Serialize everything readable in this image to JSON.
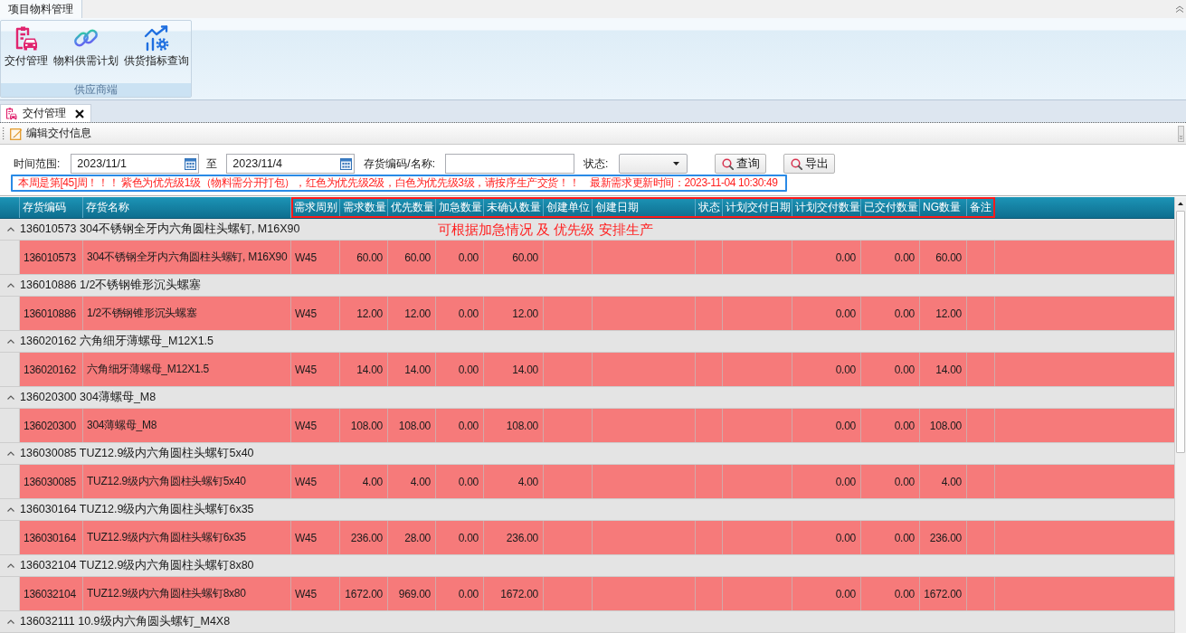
{
  "ribbon_tabs": [
    {
      "label": "项目物料管理",
      "selected": true
    }
  ],
  "ribbon": {
    "groups": [
      {
        "caption": "供应商端",
        "buttons": [
          {
            "label": "交付管理"
          },
          {
            "label": "物料供需计划"
          },
          {
            "label": "供货指标查询"
          }
        ]
      }
    ]
  },
  "document_tabs": [
    {
      "label": "交付管理",
      "selected": true
    }
  ],
  "toolbar": {
    "buttons": [
      {
        "label": "编辑交付信息"
      }
    ]
  },
  "filters": {
    "time_range": {
      "label": "时间范围:",
      "from": "2023/11/1",
      "separator": "至",
      "to": "2023/11/4"
    },
    "item": {
      "label": "存货编码/名称:"
    },
    "status": {
      "label": "状态:"
    },
    "buttons": [
      {
        "label": "查询"
      },
      {
        "label": "导出"
      }
    ]
  },
  "notice": {
    "message": "本周是第[45]周！！！ 紫色为优先级1级（物料需分开打包），红色为优先级2级，白色为优先级3级，请按序生产交货！！",
    "update_time": "最新需求更新时间：2023-11-04 10:30:49"
  },
  "table": {
    "columns": [
      {
        "label": "存货编码",
        "highlighted": false
      },
      {
        "label": "存货名称",
        "highlighted": false
      },
      {
        "label": "需求周别",
        "highlighted": true
      },
      {
        "label": "需求数量",
        "highlighted": true
      },
      {
        "label": "优先数量",
        "highlighted": true
      },
      {
        "label": "加急数量",
        "highlighted": true
      },
      {
        "label": "未确认数量",
        "highlighted": true
      },
      {
        "label": "创建单位",
        "highlighted": true
      },
      {
        "label": "创建日期",
        "highlighted": true
      },
      {
        "label": "状态",
        "highlighted": true
      },
      {
        "label": "计划交付日期",
        "highlighted": true
      },
      {
        "label": "计划交付数量",
        "highlighted": true
      },
      {
        "label": "已交付数量",
        "highlighted": true
      },
      {
        "label": "NG数量",
        "highlighted": true
      },
      {
        "label": "备注",
        "highlighted": true
      }
    ],
    "annotation": "可根据加急情况 及 优先级 安排生产",
    "groups": [
      {
        "title": "136010573 304不锈钢全牙内六角圆柱头螺钉, M16X90",
        "expanded": true,
        "rows": [
          {
            "color": "#f67a7a",
            "code": "136010573",
            "name": "304不锈钢全牙内六角圆柱头螺钉, M16X90",
            "week": "W45",
            "demand_qty": "60.00",
            "priority_qty": "60.00",
            "urgent_qty": "0.00",
            "unconfirmed_qty": "60.00",
            "planned_delivery_qty": "0.00",
            "delivered_qty": "0.00",
            "ng_qty": "60.00"
          }
        ]
      },
      {
        "title": "136010886 1/2不锈钢锥形沉头螺塞",
        "expanded": true,
        "rows": [
          {
            "color": "#f67a7a",
            "code": "136010886",
            "name": "1/2不锈钢锥形沉头螺塞",
            "week": "W45",
            "demand_qty": "12.00",
            "priority_qty": "12.00",
            "urgent_qty": "0.00",
            "unconfirmed_qty": "12.00",
            "planned_delivery_qty": "0.00",
            "delivered_qty": "0.00",
            "ng_qty": "12.00"
          }
        ]
      },
      {
        "title": "136020162 六角细牙薄螺母_M12X1.5",
        "expanded": true,
        "rows": [
          {
            "color": "#f67a7a",
            "code": "136020162",
            "name": "六角细牙薄螺母_M12X1.5",
            "week": "W45",
            "demand_qty": "14.00",
            "priority_qty": "14.00",
            "urgent_qty": "0.00",
            "unconfirmed_qty": "14.00",
            "planned_delivery_qty": "0.00",
            "delivered_qty": "0.00",
            "ng_qty": "14.00"
          }
        ]
      },
      {
        "title": "136020300 304薄螺母_M8",
        "expanded": true,
        "rows": [
          {
            "color": "#f67a7a",
            "code": "136020300",
            "name": "304薄螺母_M8",
            "week": "W45",
            "demand_qty": "108.00",
            "priority_qty": "108.00",
            "urgent_qty": "0.00",
            "unconfirmed_qty": "108.00",
            "planned_delivery_qty": "0.00",
            "delivered_qty": "0.00",
            "ng_qty": "108.00"
          }
        ]
      },
      {
        "title": "136030085 TUZ12.9级内六角圆柱头螺钉5x40",
        "expanded": true,
        "rows": [
          {
            "color": "#f67a7a",
            "code": "136030085",
            "name": "TUZ12.9级内六角圆柱头螺钉5x40",
            "week": "W45",
            "demand_qty": "4.00",
            "priority_qty": "4.00",
            "urgent_qty": "0.00",
            "unconfirmed_qty": "4.00",
            "planned_delivery_qty": "0.00",
            "delivered_qty": "0.00",
            "ng_qty": "4.00"
          }
        ]
      },
      {
        "title": "136030164 TUZ12.9级内六角圆柱头螺钉6x35",
        "expanded": true,
        "rows": [
          {
            "color": "#f67a7a",
            "code": "136030164",
            "name": "TUZ12.9级内六角圆柱头螺钉6x35",
            "week": "W45",
            "demand_qty": "236.00",
            "priority_qty": "28.00",
            "urgent_qty": "0.00",
            "unconfirmed_qty": "236.00",
            "planned_delivery_qty": "0.00",
            "delivered_qty": "0.00",
            "ng_qty": "236.00"
          }
        ]
      },
      {
        "title": "136032104 TUZ12.9级内六角圆柱头螺钉8x80",
        "expanded": true,
        "rows": [
          {
            "color": "#f67a7a",
            "code": "136032104",
            "name": "TUZ12.9级内六角圆柱头螺钉8x80",
            "week": "W45",
            "demand_qty": "1672.00",
            "priority_qty": "969.00",
            "urgent_qty": "0.00",
            "unconfirmed_qty": "1672.00",
            "planned_delivery_qty": "0.00",
            "delivered_qty": "0.00",
            "ng_qty": "1672.00"
          }
        ]
      },
      {
        "title": "136032111 10.9级内六角圆头螺钉_M4X8",
        "expanded": true
      }
    ]
  }
}
